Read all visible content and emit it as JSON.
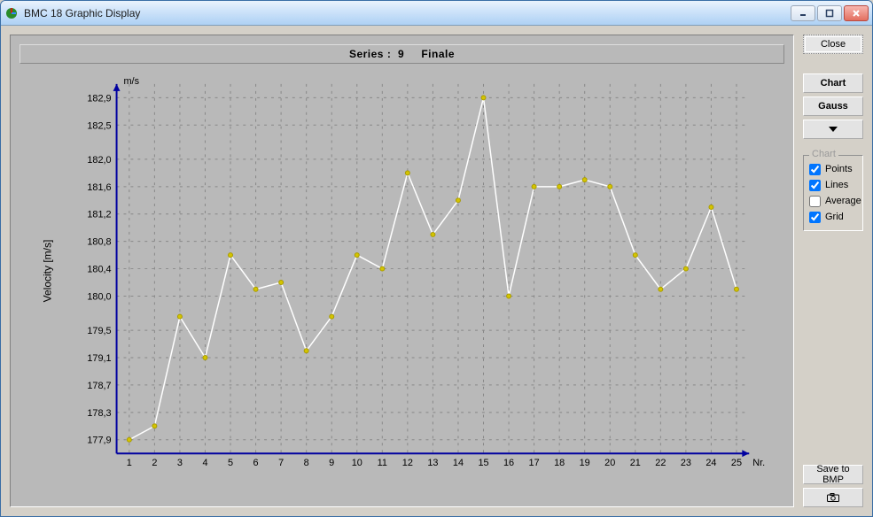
{
  "window": {
    "title": "BMC 18  Graphic Display"
  },
  "chart": {
    "title_prefix": "Series :",
    "series_number": "9",
    "series_name": "Finale",
    "y_axis_label": "Velocity [m/s]",
    "y_unit": "m/s",
    "x_unit": "Nr."
  },
  "side": {
    "close": "Close",
    "chart": "Chart",
    "gauss": "Gauss",
    "save_bmp": "Save to BMP",
    "group_label": "Chart",
    "points": "Points",
    "lines": "Lines",
    "average": "Average",
    "grid": "Grid",
    "checks": {
      "points": true,
      "lines": true,
      "average": false,
      "grid": true
    }
  },
  "chart_data": {
    "type": "line",
    "xlabel": "Nr.",
    "ylabel": "Velocity [m/s]",
    "title": "Series : 9   Finale",
    "x": [
      1,
      2,
      3,
      4,
      5,
      6,
      7,
      8,
      9,
      10,
      11,
      12,
      13,
      14,
      15,
      16,
      17,
      18,
      19,
      20,
      21,
      22,
      23,
      24,
      25
    ],
    "y": [
      177.9,
      178.1,
      179.7,
      179.1,
      180.6,
      180.1,
      180.2,
      179.2,
      179.7,
      180.6,
      180.4,
      181.8,
      180.9,
      181.4,
      182.9,
      180.0,
      181.6,
      181.6,
      181.7,
      181.6,
      180.6,
      180.1,
      180.4,
      181.3,
      180.1
    ],
    "xticks": [
      1,
      2,
      3,
      4,
      5,
      6,
      7,
      8,
      9,
      10,
      11,
      12,
      13,
      14,
      15,
      16,
      17,
      18,
      19,
      20,
      21,
      22,
      23,
      24,
      25
    ],
    "yticks": [
      177.9,
      178.3,
      178.7,
      179.1,
      179.5,
      180.0,
      180.4,
      180.8,
      181.2,
      181.6,
      182.0,
      182.5,
      182.9
    ],
    "ytick_labels": [
      "177,9",
      "178,3",
      "178,7",
      "179,1",
      "179,5",
      "180,0",
      "180,4",
      "180,8",
      "181,2",
      "181,6",
      "182,0",
      "182,5",
      "182,9"
    ],
    "xlim": [
      0.5,
      25.5
    ],
    "ylim": [
      177.7,
      183.1
    ],
    "grid": true
  }
}
